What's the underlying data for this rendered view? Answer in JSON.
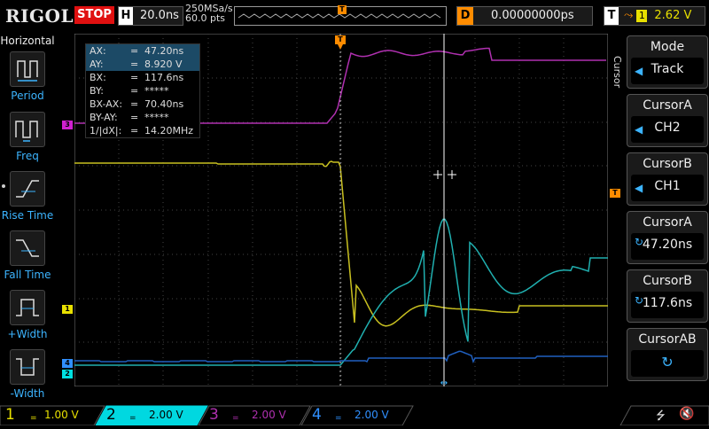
{
  "topbar": {
    "logo": "RIGOL",
    "run_state": "STOP",
    "timebase_label": "H",
    "timebase_value": "20.0ns",
    "sample_rate": "250MSa/s",
    "memory_depth": "60.0  pts",
    "trigger_marker": "T",
    "delay_label": "D",
    "delay_value": "0.00000000ps",
    "trigger_label": "T",
    "trigger_edge_symbol": "⤳",
    "trigger_source": "1",
    "trigger_level": "2.62 V"
  },
  "left_menu": {
    "title": "Horizontal",
    "items": [
      {
        "label": "Period",
        "icon": "period-icon"
      },
      {
        "label": "Freq",
        "icon": "freq-icon"
      },
      {
        "label": "Rise Time",
        "icon": "rise-time-icon"
      },
      {
        "label": "Fall Time",
        "icon": "fall-time-icon"
      },
      {
        "label": "+Width",
        "icon": "positive-width-icon"
      },
      {
        "label": "-Width",
        "icon": "negative-width-icon"
      }
    ]
  },
  "measurements": [
    {
      "key": "AX:",
      "eq": "=",
      "value": "47.20ns",
      "highlight": true
    },
    {
      "key": "AY:",
      "eq": "=",
      "value": "8.920 V",
      "highlight": true
    },
    {
      "key": "BX:",
      "eq": "=",
      "value": "117.6ns",
      "highlight": false
    },
    {
      "key": "BY:",
      "eq": "=",
      "value": "*****",
      "highlight": false
    },
    {
      "key": "BX-AX:",
      "eq": "=",
      "value": "70.40ns",
      "highlight": false
    },
    {
      "key": "BY-AY:",
      "eq": "=",
      "value": "*****",
      "highlight": false
    },
    {
      "key": "1/|dX|:",
      "eq": "=",
      "value": "14.20MHz",
      "highlight": false
    }
  ],
  "channel_markers": {
    "ch1": "1",
    "ch2": "2",
    "ch3": "3",
    "ch4": "4",
    "trigger_level": "T"
  },
  "right_menu": {
    "side_tab": "Cursor",
    "buttons": [
      {
        "title": "Mode",
        "value": "Track"
      },
      {
        "title": "CursorA",
        "value": "CH2"
      },
      {
        "title": "CursorB",
        "value": "CH1"
      },
      {
        "title": "CursorA",
        "value": "47.20ns"
      },
      {
        "title": "CursorB",
        "value": "117.6ns"
      },
      {
        "title": "CursorAB",
        "value": ""
      }
    ]
  },
  "bottom_bar": {
    "channels": [
      {
        "num": "1",
        "coupling": "=",
        "scale": "1.00 V",
        "color": "#e8e000"
      },
      {
        "num": "2",
        "coupling": "=",
        "scale": "2.00 V",
        "color": "#00e0e0"
      },
      {
        "num": "3",
        "coupling": "=",
        "scale": "2.00 V",
        "color": "#d020d0"
      },
      {
        "num": "4",
        "coupling": "=",
        "scale": "2.00 V",
        "color": "#3090ff"
      }
    ]
  },
  "colors": {
    "ch1": "#c8c020",
    "ch2": "#20b0b0",
    "ch3": "#b030b0",
    "ch4": "#2060c0",
    "accent": "#3cb4ff",
    "trigger": "#ff8c00"
  },
  "waveforms": {
    "ch1_pts": [
      [
        0,
        0,
        148
      ],
      [
        120,
        0,
        148
      ],
      [
        270,
        -2,
        148
      ],
      [
        285,
        -8,
        152
      ],
      [
        292,
        -10,
        150
      ],
      [
        298,
        -2,
        142
      ],
      [
        305,
        80,
        60
      ],
      [
        310,
        170,
        0
      ],
      [
        316,
        220,
        -40
      ],
      [
        320,
        215,
        -40
      ],
      [
        330,
        160,
        20
      ],
      [
        340,
        150,
        40
      ],
      [
        350,
        170,
        20
      ],
      [
        360,
        180,
        10
      ],
      [
        380,
        165,
        30
      ],
      [
        400,
        155,
        40
      ],
      [
        420,
        150,
        50
      ],
      [
        440,
        145,
        52
      ],
      [
        460,
        165,
        30
      ],
      [
        475,
        180,
        20
      ],
      [
        490,
        170,
        30
      ],
      [
        510,
        150,
        42
      ],
      [
        530,
        148,
        44
      ],
      [
        560,
        148,
        44
      ],
      [
        602,
        148,
        44
      ]
    ],
    "ch3_pts": [
      [
        0,
        100,
        0
      ],
      [
        280,
        100,
        0
      ],
      [
        290,
        100,
        -2
      ],
      [
        298,
        85,
        10
      ],
      [
        305,
        30,
        40
      ],
      [
        312,
        5,
        55
      ],
      [
        330,
        8,
        55
      ],
      [
        350,
        5,
        55
      ],
      [
        380,
        10,
        55
      ],
      [
        402,
        8,
        55
      ],
      [
        420,
        8,
        55
      ],
      [
        445,
        2,
        55
      ],
      [
        460,
        5,
        55
      ],
      [
        475,
        15,
        55
      ],
      [
        490,
        20,
        55
      ],
      [
        520,
        20,
        55
      ],
      [
        560,
        17,
        55
      ],
      [
        602,
        17,
        55
      ]
    ]
  }
}
